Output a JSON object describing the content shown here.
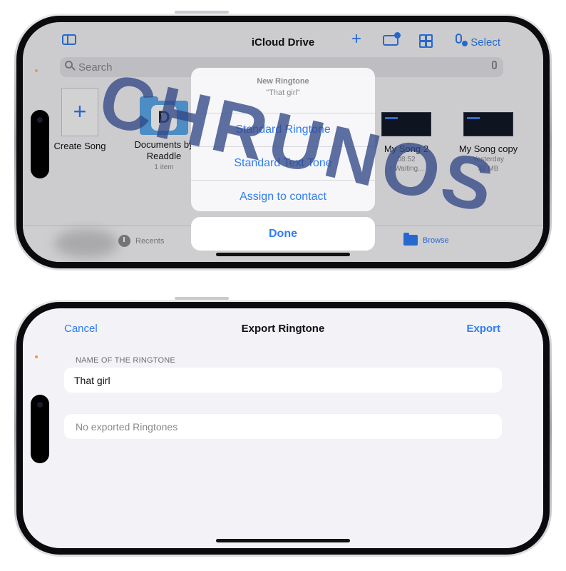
{
  "top_screen": {
    "title": "iCloud Drive",
    "select_label": "Select",
    "search_placeholder": "Search",
    "files": [
      {
        "name": "Create Song"
      },
      {
        "name": "Documents by Readdle",
        "sub": "1 item"
      },
      {
        "name": "My Song 2",
        "sub1": "08:52",
        "sub2": "↑ Waiting..."
      },
      {
        "name": "My Song copy",
        "sub1": "Yesterday",
        "sub2": "32 MB"
      }
    ],
    "tabs": {
      "recents": "Recents",
      "browse": "Browse"
    },
    "action_sheet": {
      "title": "New Ringtone",
      "message": "\"That girl\"",
      "items": [
        "Standard Ringtone",
        "Standard Text Tone",
        "Assign to contact"
      ],
      "done": "Done"
    }
  },
  "watermark": "CHRUNOS",
  "bottom_screen": {
    "cancel": "Cancel",
    "title": "Export Ringtone",
    "export": "Export",
    "section_label": "NAME OF THE RINGTONE",
    "name_value": "That girl",
    "empty_text": "No exported Ringtones"
  },
  "colors": {
    "accent": "#2f7cf6",
    "secondary_text": "#8a8a8f"
  }
}
